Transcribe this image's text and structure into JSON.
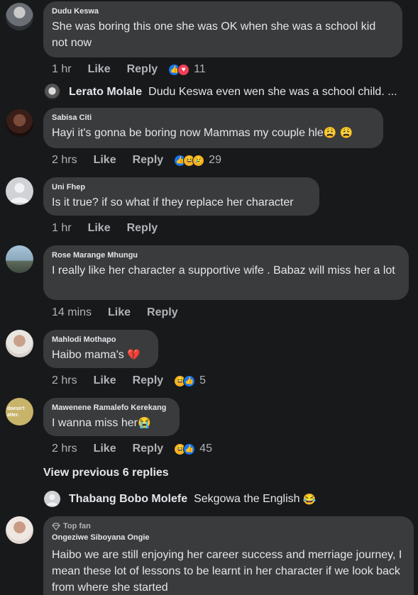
{
  "comments": [
    {
      "author": "Dudu Keswa",
      "text": "She was boring this one she was OK when she was a school kid not now",
      "time": "1 hr",
      "like": "Like",
      "reply": "Reply",
      "reaction_count": "11"
    },
    {
      "author": "Sabisa Citi",
      "text": "Hayi it's gonna be boring now Mammas my couple hle",
      "emoji": "😩 😩",
      "time": "2 hrs",
      "like": "Like",
      "reply": "Reply",
      "reaction_count": "29"
    },
    {
      "author": "Uni Fhep",
      "text": "Is it true? if so what if they replace her character",
      "time": "1 hr",
      "like": "Like",
      "reply": "Reply"
    },
    {
      "author": "Rose Marange Mhungu",
      "text": "I really like her character a supportive wife . Babaz will miss her a lot",
      "time": "14 mins",
      "like": "Like",
      "reply": "Reply"
    },
    {
      "author": "Mahlodi Mothapo",
      "text": "Haibo mama's",
      "emoji": "💔",
      "time": "2 hrs",
      "like": "Like",
      "reply": "Reply",
      "reaction_count": "5"
    },
    {
      "author": "Mawenene Ramalefo Kerekang",
      "avatar_text": "doesn't atter.",
      "text": "I wanna miss her",
      "emoji": "😭",
      "time": "2 hrs",
      "like": "Like",
      "reply": "Reply",
      "reaction_count": "45"
    },
    {
      "author": "Ongeziwe Siboyana Ongie",
      "badge": "Top fan",
      "text": "Haibo we are still enjoying her career success and merriage journey,  I mean these lot of lessons to be learnt in her character if we look back from where she started"
    }
  ],
  "replies": [
    {
      "name": "Lerato Molale",
      "text": "Dudu Keswa even wen she was a school child. ..."
    },
    {
      "name": "Thabang Bobo Molefe",
      "text": "Sekgowa the English",
      "emoji": "😂"
    }
  ],
  "view_previous": "View previous 6 replies",
  "colors": {
    "background": "#18191a",
    "bubble": "#3a3b3c",
    "text": "#e4e6eb",
    "secondary": "#b0b3b8",
    "like_blue": "#1877f2",
    "love_red": "#f33e58"
  }
}
